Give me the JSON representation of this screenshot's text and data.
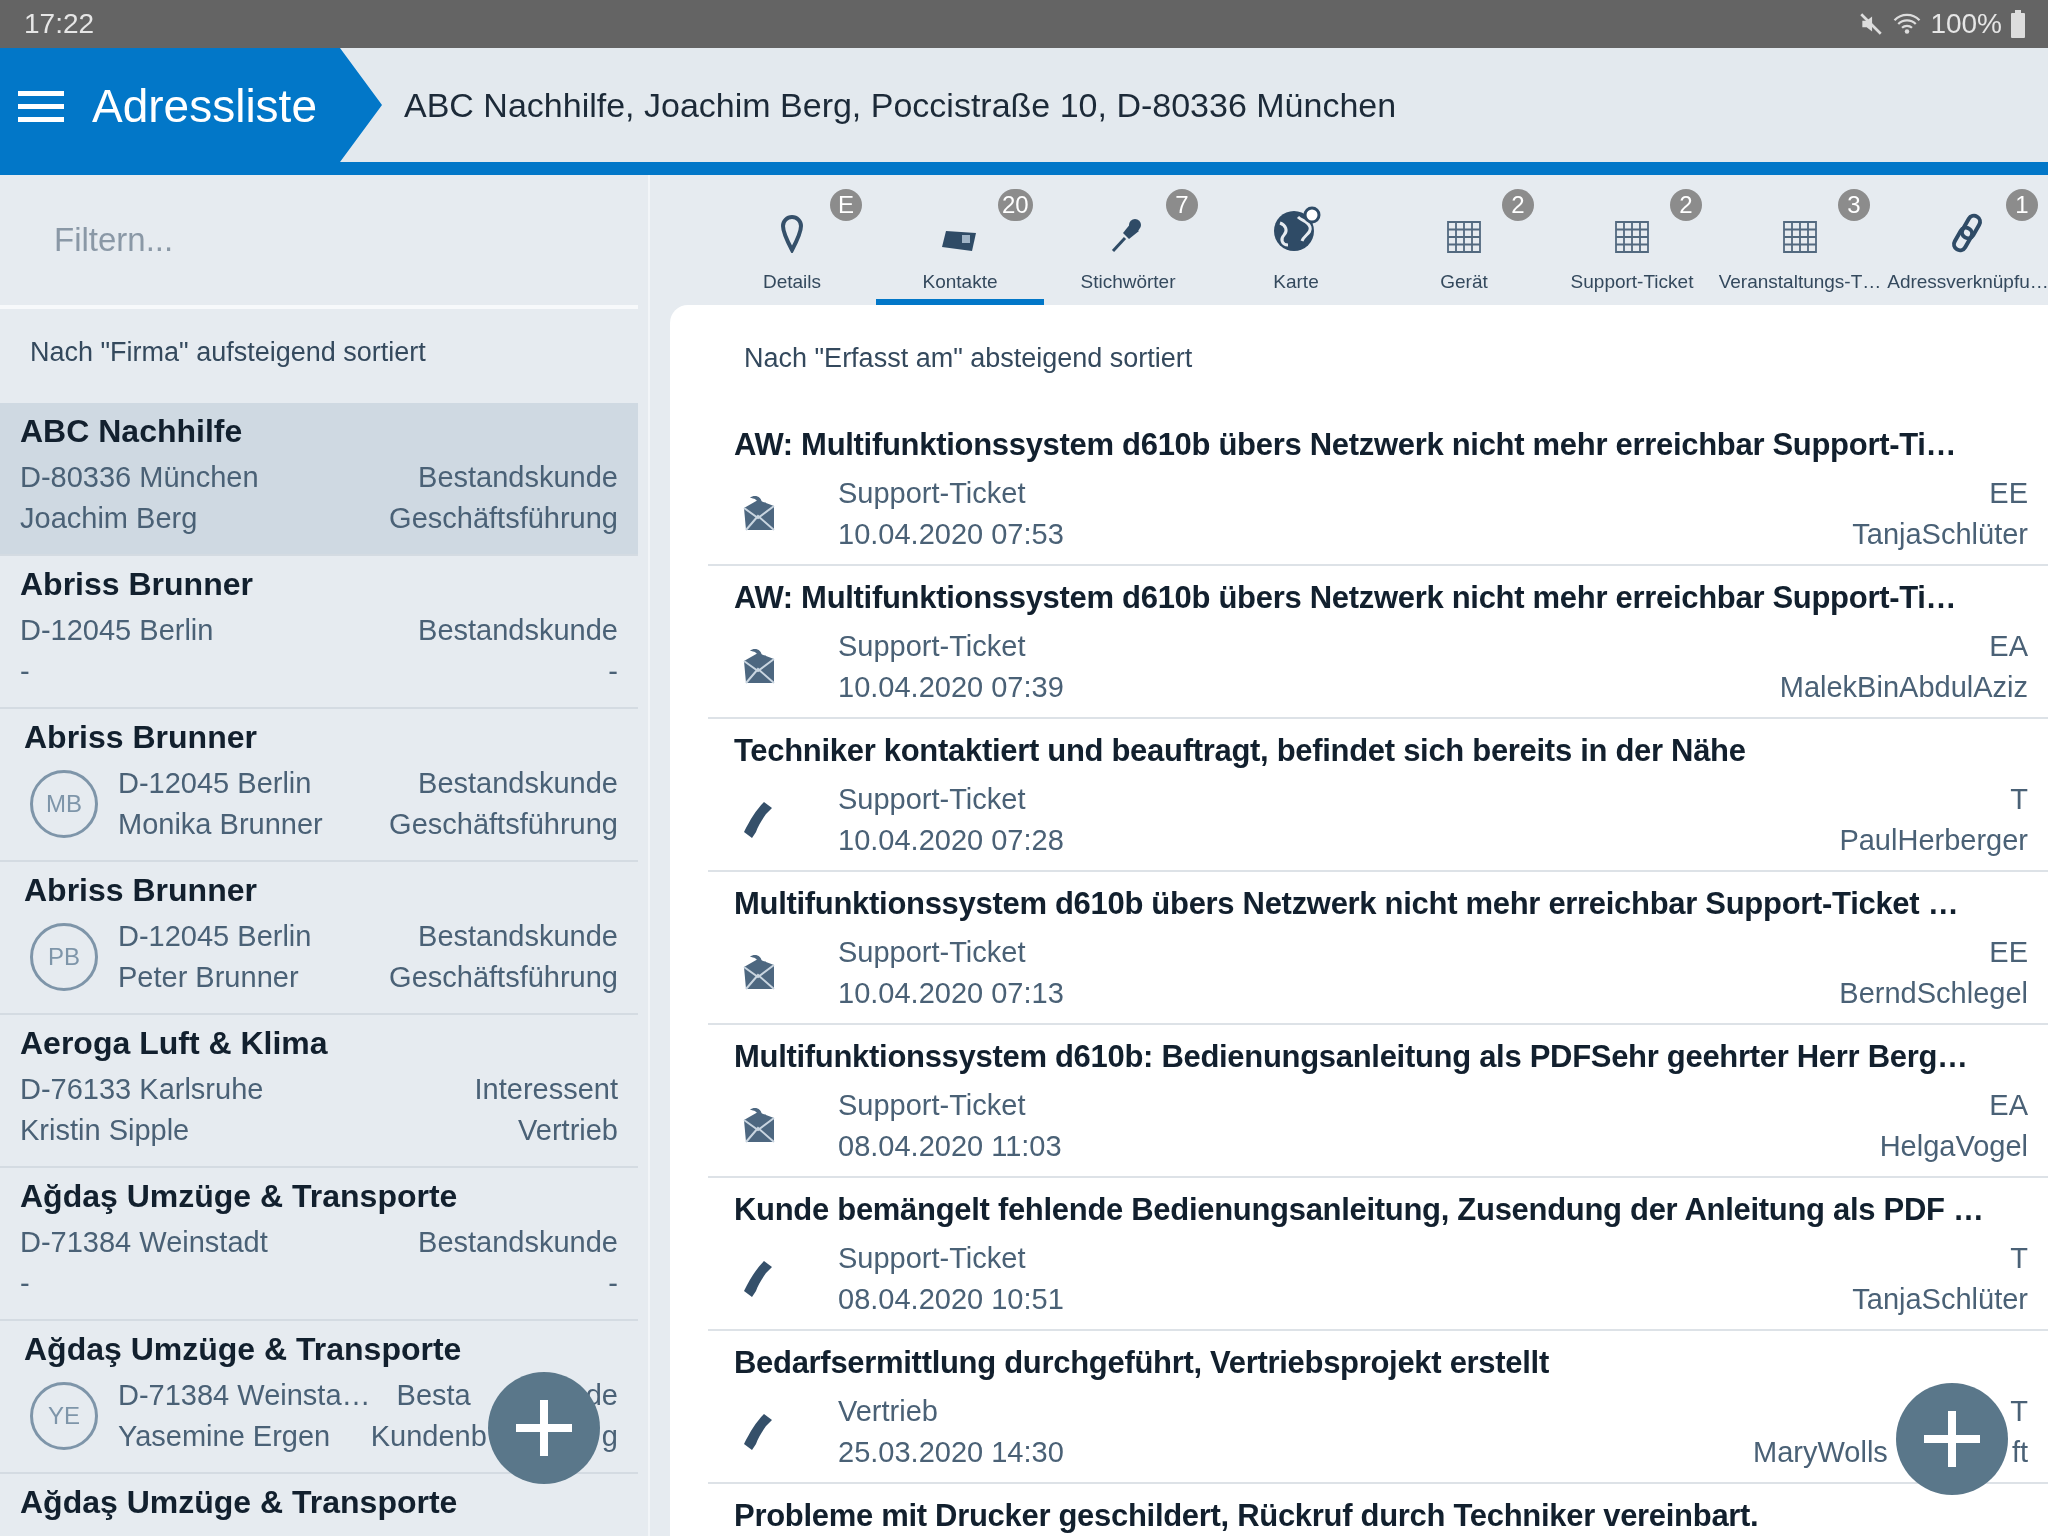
{
  "status_bar": {
    "time": "17:22",
    "battery": "100%"
  },
  "header": {
    "title": "Adressliste",
    "breadcrumb": "ABC Nachhilfe, Joachim Berg, Poccistraße 10, D-80336 München"
  },
  "sidebar": {
    "filter": {
      "placeholder": "Filtern..."
    },
    "sort_label": "Nach \"Firma\" aufsteigend sortiert",
    "items": [
      {
        "title": "ABC Nachhilfe",
        "selected": true,
        "rows": [
          {
            "left": "D-80336 München",
            "right": "Bestandskunde"
          },
          {
            "left": "Joachim Berg",
            "right": "Geschäftsführung"
          }
        ]
      },
      {
        "title": "Abriss Brunner",
        "selected": false,
        "rows": [
          {
            "left": "D-12045 Berlin",
            "right": "Bestandskunde"
          },
          {
            "left": "-",
            "right": "-"
          }
        ]
      },
      {
        "title": "Abriss Brunner",
        "selected": false,
        "avatar": "MB",
        "rows": [
          {
            "left": "D-12045 Berlin",
            "right": "Bestandskunde"
          },
          {
            "left": "Monika Brunner",
            "right": "Geschäftsführung"
          }
        ]
      },
      {
        "title": "Abriss Brunner",
        "selected": false,
        "avatar": "PB",
        "rows": [
          {
            "left": "D-12045 Berlin",
            "right": "Bestandskunde"
          },
          {
            "left": "Peter Brunner",
            "right": "Geschäftsführung"
          }
        ]
      },
      {
        "title": "Aeroga Luft & Klima",
        "selected": false,
        "rows": [
          {
            "left": "D-76133 Karlsruhe",
            "right": "Interessent"
          },
          {
            "left": "Kristin Sipple",
            "right": "Vertrieb"
          }
        ]
      },
      {
        "title": "Ağdaş Umzüge & Transporte",
        "selected": false,
        "rows": [
          {
            "left": "D-71384 Weinstadt",
            "right": "Bestandskunde"
          },
          {
            "left": "-",
            "right": "-"
          }
        ]
      },
      {
        "title": "Ağdaş Umzüge & Transporte",
        "selected": false,
        "avatar": "YE",
        "rows": [
          {
            "left": "D-71384 Weinsta…",
            "right": "Besta",
            "right_end": "de"
          },
          {
            "left": "Yasemine Ergen",
            "right": "Kundenb",
            "right_end": "g"
          }
        ]
      },
      {
        "title": "Ağdaş Umzüge & Transporte",
        "selected": false
      }
    ]
  },
  "tabs": [
    {
      "label": "Details",
      "kind": "pin",
      "badge": "E",
      "selected": false
    },
    {
      "label": "Kontakte",
      "kind": "card",
      "badge": "20",
      "selected": true
    },
    {
      "label": "Stichwörter",
      "kind": "pushpin",
      "badge": "7",
      "selected": false
    },
    {
      "label": "Karte",
      "kind": "globe",
      "selected": false
    },
    {
      "label": "Gerät",
      "kind": "grid",
      "badge": "2",
      "selected": false
    },
    {
      "label": "Support-Ticket",
      "kind": "grid",
      "badge": "2",
      "selected": false
    },
    {
      "label": "Veranstaltungs-T…",
      "kind": "grid",
      "badge": "3",
      "selected": false
    },
    {
      "label": "Adressverknüpfu…",
      "kind": "link",
      "badge": "1",
      "selected": false
    }
  ],
  "contacts": {
    "sort_label": "Nach \"Erfasst am\" absteigend sortiert",
    "items": [
      {
        "title": "AW: Multifunktionssystem d610b übers Netzwerk nicht mehr erreichbar Support-Ti…",
        "kind": "mail",
        "type": "Support-Ticket",
        "date": "10.04.2020 07:53",
        "code": "EE",
        "user": "TanjaSchlüter"
      },
      {
        "title": "AW: Multifunktionssystem d610b übers Netzwerk nicht mehr erreichbar Support-Ti…",
        "kind": "mail",
        "type": "Support-Ticket",
        "date": "10.04.2020 07:39",
        "code": "EA",
        "user": "MalekBinAbdulAziz"
      },
      {
        "title": "Techniker kontaktiert und beauftragt, befindet sich bereits in der Nähe",
        "kind": "phone",
        "type": "Support-Ticket",
        "date": "10.04.2020 07:28",
        "code": "T",
        "user": "PaulHerberger"
      },
      {
        "title": "Multifunktionssystem d610b übers Netzwerk nicht mehr erreichbar Support-Ticket …",
        "kind": "mail",
        "type": "Support-Ticket",
        "date": "10.04.2020 07:13",
        "code": "EE",
        "user": "BerndSchlegel"
      },
      {
        "title": "Multifunktionssystem d610b: Bedienungsanleitung als PDFSehr geehrter Herr Berg…",
        "kind": "mail",
        "type": "Support-Ticket",
        "date": "08.04.2020 11:03",
        "code": "EA",
        "user": "HelgaVogel"
      },
      {
        "title": "Kunde bemängelt fehlende Bedienungsanleitung, Zusendung der Anleitung als PDF …",
        "kind": "phone",
        "type": "Support-Ticket",
        "date": "08.04.2020 10:51",
        "code": "T",
        "user": "TanjaSchlüter"
      },
      {
        "title": "Bedarfsermittlung durchgeführt, Vertriebsprojekt erstellt",
        "kind": "phone",
        "type": "Vertrieb",
        "date": "25.03.2020 14:30",
        "code": "T",
        "user": "MaryWolls",
        "user_end": "ft"
      },
      {
        "title": "Probleme mit Drucker geschildert, Rückruf durch Techniker vereinbart."
      }
    ]
  }
}
